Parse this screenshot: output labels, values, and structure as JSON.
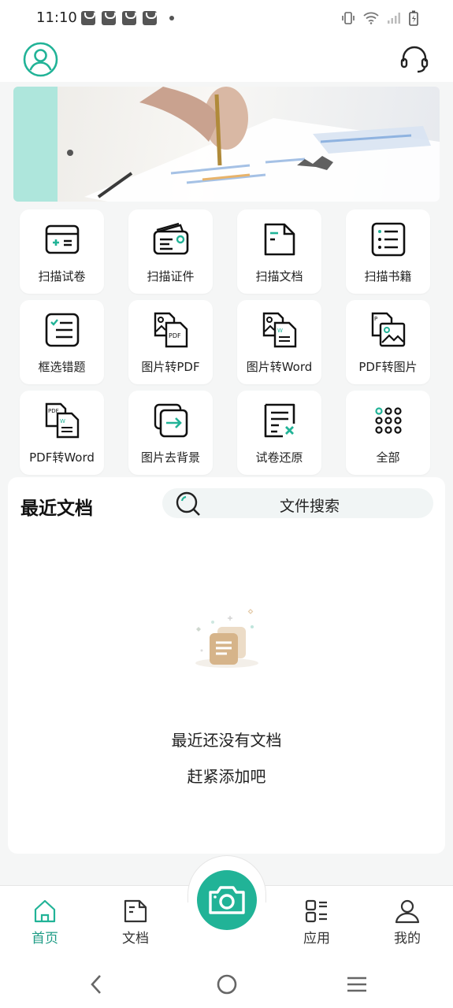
{
  "status_bar": {
    "time": "11:10"
  },
  "header": {
    "avatar_icon": "user-circle-icon",
    "support_icon": "headset-icon"
  },
  "tiles": [
    {
      "label": "扫描试卷",
      "icon": "scan-paper-icon"
    },
    {
      "label": "扫描证件",
      "icon": "scan-id-icon"
    },
    {
      "label": "扫描文档",
      "icon": "scan-document-icon"
    },
    {
      "label": "扫描书籍",
      "icon": "scan-book-icon"
    },
    {
      "label": "框选错题",
      "icon": "select-mistakes-icon"
    },
    {
      "label": "图片转PDF",
      "icon": "image-to-pdf-icon"
    },
    {
      "label": "图片转Word",
      "icon": "image-to-word-icon"
    },
    {
      "label": "PDF转图片",
      "icon": "pdf-to-image-icon"
    },
    {
      "label": "PDF转Word",
      "icon": "pdf-to-word-icon"
    },
    {
      "label": "图片去背景",
      "icon": "remove-background-icon"
    },
    {
      "label": "试卷还原",
      "icon": "restore-paper-icon"
    },
    {
      "label": "全部",
      "icon": "all-apps-icon"
    }
  ],
  "recent": {
    "title": "最近文档",
    "search_label": "文件搜索",
    "empty_line1": "最近还没有文档",
    "empty_line2": "赶紧添加吧"
  },
  "bottom_nav": {
    "items": [
      {
        "label": "首页",
        "icon": "home-icon"
      },
      {
        "label": "文档",
        "icon": "document-icon"
      },
      {
        "label": "应用",
        "icon": "apps-icon"
      },
      {
        "label": "我的",
        "icon": "profile-icon"
      }
    ],
    "camera_icon": "camera-icon"
  },
  "colors": {
    "accent": "#21b397",
    "accent_text": "#1f9c86",
    "banner_teal": "#aee6dc"
  }
}
